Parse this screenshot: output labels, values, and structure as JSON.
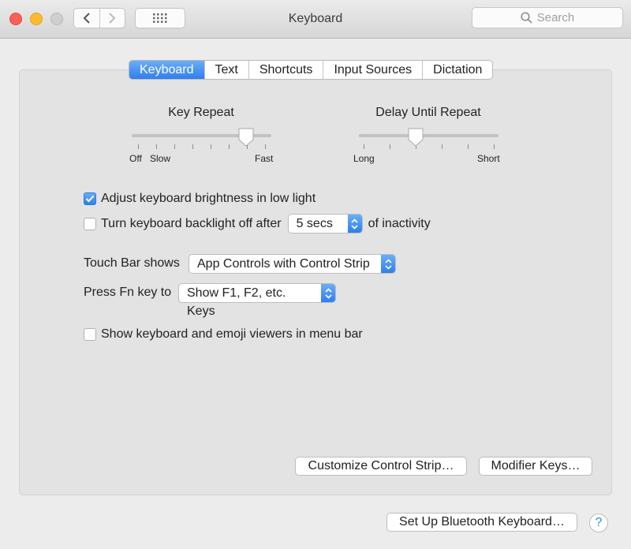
{
  "window": {
    "title": "Keyboard"
  },
  "search": {
    "placeholder": "Search"
  },
  "tabs": [
    {
      "label": "Keyboard",
      "active": true
    },
    {
      "label": "Text",
      "active": false
    },
    {
      "label": "Shortcuts",
      "active": false
    },
    {
      "label": "Input Sources",
      "active": false
    },
    {
      "label": "Dictation",
      "active": false
    }
  ],
  "key_repeat": {
    "title": "Key Repeat",
    "labels": [
      "Off",
      "Slow",
      "Fast"
    ],
    "level": 0.83
  },
  "delay_until_repeat": {
    "title": "Delay Until Repeat",
    "labels": [
      "Long",
      "Short"
    ],
    "level": 0.4
  },
  "options": {
    "brightness": {
      "label": "Adjust keyboard brightness in low light",
      "checked": true
    },
    "backlight": {
      "label": "Turn keyboard backlight off after",
      "checked": false,
      "value": "5 secs",
      "suffix": "of inactivity"
    },
    "emoji": {
      "label": "Show keyboard and emoji viewers in menu bar",
      "checked": false
    }
  },
  "touch_bar": {
    "label": "Touch Bar shows",
    "value": "App Controls with Control Strip"
  },
  "fn_key": {
    "label": "Press Fn key to",
    "value": "Show F1, F2, etc. Keys"
  },
  "buttons": {
    "customize": "Customize Control Strip…",
    "modifier": "Modifier Keys…",
    "bluetooth": "Set Up Bluetooth Keyboard…",
    "help": "?"
  },
  "colors": {
    "accent": "#2f7ef0",
    "close": "#fc5f57",
    "minimize": "#fdbc2e"
  }
}
